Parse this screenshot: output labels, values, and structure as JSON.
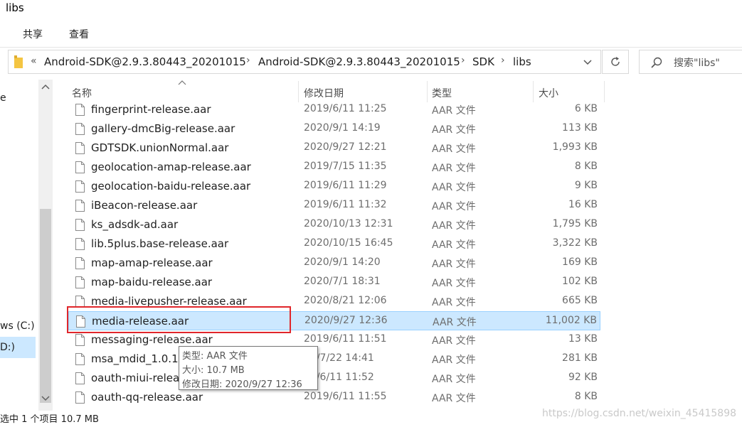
{
  "window": {
    "title": "libs"
  },
  "ribbon": {
    "tabs": [
      "共享",
      "查看"
    ]
  },
  "address": {
    "back_marker": "«",
    "breadcrumb": [
      "Android-SDK@2.9.3.80443_20201015",
      "Android-SDK@2.9.3.80443_20201015",
      "SDK",
      "libs"
    ],
    "separator": "›"
  },
  "search": {
    "placeholder": "搜索\"libs\""
  },
  "nav": {
    "partial_top": "e",
    "drive_c": "ws (C:)",
    "drive_d": "D:)"
  },
  "columns": {
    "name": "名称",
    "date": "修改日期",
    "type": "类型",
    "size": "大小"
  },
  "files": [
    {
      "name": "fingerprint-release.aar",
      "date": "2019/6/11 11:25",
      "type": "AAR 文件",
      "size": "6 KB"
    },
    {
      "name": "gallery-dmcBig-release.aar",
      "date": "2020/9/1 14:19",
      "type": "AAR 文件",
      "size": "113 KB"
    },
    {
      "name": "GDTSDK.unionNormal.aar",
      "date": "2020/9/27 12:21",
      "type": "AAR 文件",
      "size": "1,993 KB"
    },
    {
      "name": "geolocation-amap-release.aar",
      "date": "2019/7/15 11:35",
      "type": "AAR 文件",
      "size": "8 KB"
    },
    {
      "name": "geolocation-baidu-release.aar",
      "date": "2019/6/11 11:29",
      "type": "AAR 文件",
      "size": "9 KB"
    },
    {
      "name": "iBeacon-release.aar",
      "date": "2019/6/11 11:32",
      "type": "AAR 文件",
      "size": "16 KB"
    },
    {
      "name": "ks_adsdk-ad.aar",
      "date": "2020/10/13 12:31",
      "type": "AAR 文件",
      "size": "1,795 KB"
    },
    {
      "name": "lib.5plus.base-release.aar",
      "date": "2020/10/15 16:45",
      "type": "AAR 文件",
      "size": "3,322 KB"
    },
    {
      "name": "map-amap-release.aar",
      "date": "2020/9/1 14:20",
      "type": "AAR 文件",
      "size": "169 KB"
    },
    {
      "name": "map-baidu-release.aar",
      "date": "2020/7/1 18:31",
      "type": "AAR 文件",
      "size": "102 KB"
    },
    {
      "name": "media-livepusher-release.aar",
      "date": "2020/8/21 12:06",
      "type": "AAR 文件",
      "size": "665 KB"
    },
    {
      "name": "media-release.aar",
      "date": "2020/9/27 12:36",
      "type": "AAR 文件",
      "size": "11,002 KB",
      "selected": true
    },
    {
      "name": "messaging-release.aar",
      "date": "2019/6/11 11:51",
      "type": "AAR 文件",
      "size": "13 KB"
    },
    {
      "name": "msa_mdid_1.0.13",
      "date": "20/7/22 14:41",
      "type": "AAR 文件",
      "size": "281 KB"
    },
    {
      "name": "oauth-miui-relea",
      "date": "19/6/11 11:52",
      "type": "AAR 文件",
      "size": "92 KB"
    },
    {
      "name": "oauth-qq-release.aar",
      "date": "2019/6/11 11:55",
      "type": "AAR 文件",
      "size": "8 KB"
    }
  ],
  "tooltip": {
    "type_line": "类型: AAR 文件",
    "size_line": "大小: 10.7 MB",
    "date_line": "修改日期: 2020/9/27 12:36"
  },
  "status": {
    "text": "选中 1 个项目  10.7 MB"
  },
  "watermark": {
    "text": "https://blog.csdn.net/weixin_45415898"
  },
  "colors": {
    "selection": "#cce8ff",
    "selection_border": "#99d1ff",
    "highlight_box": "#e0262b"
  },
  "icons": {
    "folder": "folder-icon",
    "search": "search-icon",
    "refresh": "refresh-icon",
    "file": "file-icon"
  }
}
